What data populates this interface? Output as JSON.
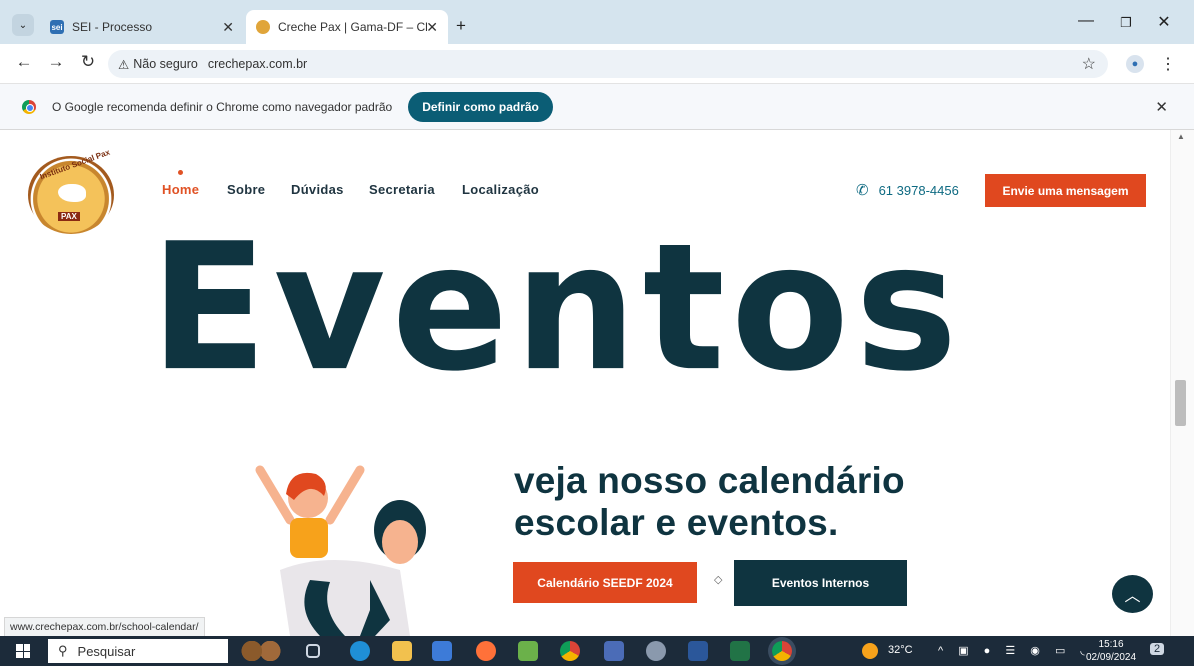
{
  "browser": {
    "tabs": [
      {
        "title": "SEI - Processo",
        "icon": "sei-icon",
        "active": false
      },
      {
        "title": "Creche Pax | Gama-DF – Clique",
        "icon": "site-favicon",
        "active": true
      }
    ],
    "new_tab": "+",
    "security_label": "Não seguro",
    "url": "crechepax.com.br",
    "infobar": {
      "message": "O Google recomenda definir o Chrome como navegador padrão",
      "button": "Definir como padrão"
    }
  },
  "site": {
    "logo_text": "Instituto Social Pax",
    "logo_badge": "PAX",
    "nav": [
      "Home",
      "Sobre",
      "Dúvidas",
      "Secretaria",
      "Localização"
    ],
    "phone": "61 3978-4456",
    "message_button": "Envie uma mensagem",
    "hero_title": "Eventos",
    "subtitle_line1": "veja nosso calendário",
    "subtitle_line2": "escolar e eventos.",
    "button_calendar": "Calendário SEEDF 2024",
    "button_events": "Eventos Internos",
    "separator": "◇"
  },
  "status_url": "www.crechepax.com.br/school-calendar/",
  "taskbar": {
    "search_placeholder": "Pesquisar",
    "temperature": "32°C",
    "time": "15:16",
    "date": "02/09/2024",
    "notifications": "2"
  },
  "colors": {
    "accent": "#e0481f",
    "dark": "#0f3440",
    "teal": "#0b5d75"
  }
}
